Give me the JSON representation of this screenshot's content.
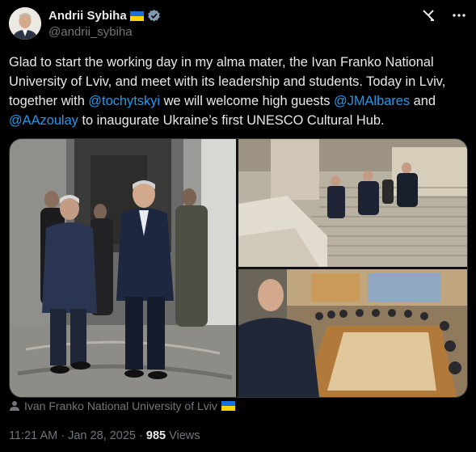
{
  "author": {
    "name": "Andrii Sybiha",
    "handle": "@andrii_sybiha",
    "flag_colors": [
      "#1d6fd8",
      "#ffd500"
    ],
    "verified_color": "#829aab"
  },
  "tweet": {
    "part1": "Glad to start the working day in my alma mater, the Ivan Franko National University of Lviv, and meet with its leadership and students. Today in Lviv, together with ",
    "mention1": "@tochytskyi",
    "part2": " we will welcome high guests ",
    "mention2": "@JMAlbares",
    "part3": " and ",
    "mention3": "@AAzoulay",
    "part4": " to inaugurate Ukraine’s first UNESCO Cultural Hub."
  },
  "location": "Ivan Franko National University of Lviv",
  "meta": {
    "time": "11:21 AM",
    "separator": "·",
    "date": "Jan 28, 2025",
    "views_count": "985",
    "views_label": "Views"
  },
  "icons": [
    "grok-icon",
    "more-icon",
    "verified-icon",
    "location-icon"
  ],
  "colors": {
    "link": "#1d9bf0",
    "muted": "#71767b",
    "text": "#e7e9ea",
    "background": "#000000"
  }
}
